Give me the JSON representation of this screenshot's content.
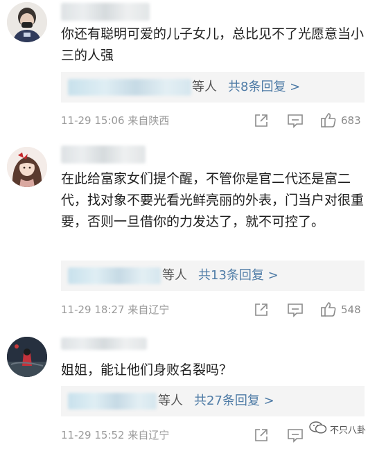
{
  "comments": [
    {
      "text": "你还有聪明可爱的儿子女儿，总比见不了光愿意当小三的人强",
      "reply_who": "等人",
      "reply_count": "共8条回复 >",
      "meta": "11-29 15:06 来自陕西",
      "likes": "683"
    },
    {
      "text": "在此给富家女们提个醒，不管你是官二代还是富二代，找对象不要光看光鲜亮丽的外表，门当户对很重要，否则一旦借你的力发达了，就不可控了。",
      "reply_who": "等人",
      "reply_count": "共13条回复 >",
      "meta": "11-29 18:27 来自辽宁",
      "likes": "548"
    },
    {
      "text": "姐姐，能让他们身败名裂吗？",
      "reply_who": "等人",
      "reply_count": "共27条回复 >",
      "meta": "11-29 15:52 来自辽宁",
      "likes": ""
    }
  ],
  "icons": {
    "share": "share-icon",
    "comment": "comment-icon",
    "like": "thumbs-up-icon"
  },
  "watermark": {
    "text": "不只八卦"
  },
  "colors": {
    "link": "#4e7ba6",
    "meta": "#9a9a9a",
    "reply_bg": "#f4f4f4"
  }
}
